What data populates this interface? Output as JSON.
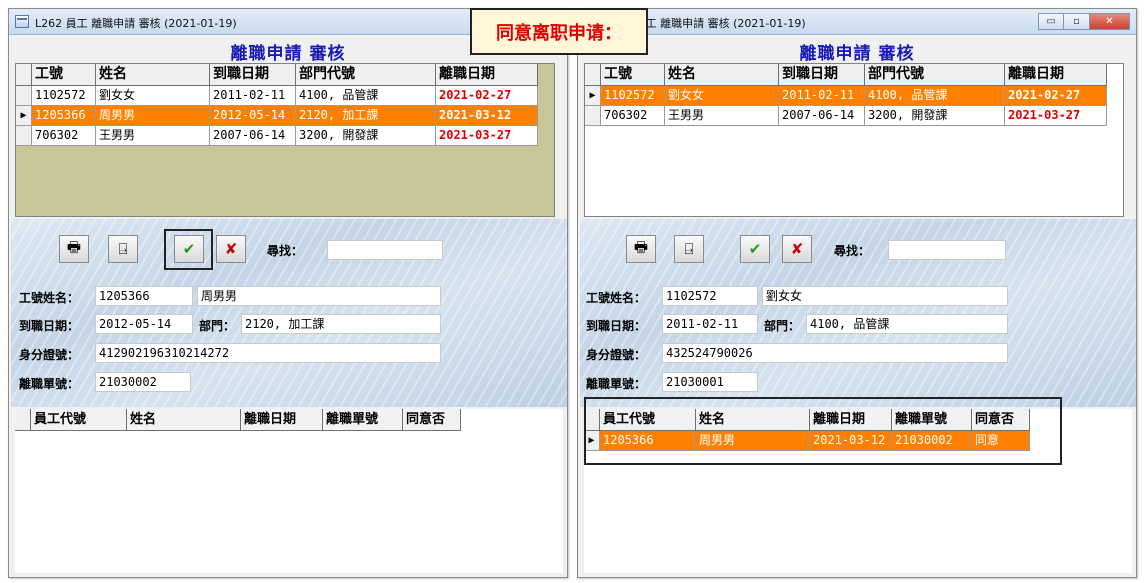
{
  "left": {
    "window_title": "L262 員工 離職申請 審核 (2021-01-19)",
    "form_title": "離職申請 審核",
    "grid_headers": [
      "工號",
      "姓名",
      "到職日期",
      "部門代號",
      "離職日期"
    ],
    "rows": [
      {
        "id": "1102572",
        "name": "劉女女",
        "join": "2011-02-11",
        "dept": "4100, 品管課",
        "leave": "2021-02-27",
        "selected": false
      },
      {
        "id": "1205366",
        "name": "周男男",
        "join": "2012-05-14",
        "dept": "2120, 加工課",
        "leave": "2021-03-12",
        "selected": true
      },
      {
        "id": "706302",
        "name": "王男男",
        "join": "2007-06-14",
        "dept": "3200, 開發課",
        "leave": "2021-03-27",
        "selected": false
      }
    ],
    "search_label": "尋找：",
    "search_value": "",
    "labels": {
      "emp": "工號姓名：",
      "join": "到職日期：",
      "dept": "部門：",
      "idno": "身分證號：",
      "form_no": "離職單號："
    },
    "detail": {
      "emp_id": "1205366",
      "emp_name": "周男男",
      "join_date": "2012-05-14",
      "dept": "2120, 加工課",
      "id_number": "412902196310214272",
      "form_no": "21030002"
    },
    "grid2_headers": [
      "員工代號",
      "姓名",
      "離職日期",
      "離職單號",
      "同意否"
    ],
    "grid2_rows": []
  },
  "right": {
    "window_title": "L262 員工 離職申請 審核 (2021-01-19)",
    "form_title": "離職申請 審核",
    "grid_headers": [
      "工號",
      "姓名",
      "到職日期",
      "部門代號",
      "離職日期"
    ],
    "rows": [
      {
        "id": "1102572",
        "name": "劉女女",
        "join": "2011-02-11",
        "dept": "4100, 品管課",
        "leave": "2021-02-27",
        "selected": true
      },
      {
        "id": "706302",
        "name": "王男男",
        "join": "2007-06-14",
        "dept": "3200, 開發課",
        "leave": "2021-03-27",
        "selected": false
      }
    ],
    "search_label": "尋找：",
    "search_value": "",
    "labels": {
      "emp": "工號姓名：",
      "join": "到職日期：",
      "dept": "部門：",
      "idno": "身分證號：",
      "form_no": "離職單號："
    },
    "detail": {
      "emp_id": "1102572",
      "emp_name": "劉女女",
      "join_date": "2011-02-11",
      "dept": "4100, 品管課",
      "id_number": "432524790026",
      "form_no": "21030001"
    },
    "grid2_headers": [
      "員工代號",
      "姓名",
      "離職日期",
      "離職單號",
      "同意否"
    ],
    "grid2_rows": [
      {
        "id": "1205366",
        "name": "周男男",
        "leave": "2021-03-12",
        "form_no": "21030002",
        "agree": "同意",
        "selected": true
      }
    ]
  },
  "window_buttons": {
    "min": "▭",
    "max": "▫",
    "close": "✕"
  },
  "toolbar_icons": [
    "print-icon",
    "exit-icon",
    "confirm-icon",
    "reject-icon"
  ],
  "toolbar_glyphs": {
    "print": "🖶",
    "exit": "⍈",
    "confirm": "✔",
    "reject": "✘"
  },
  "row_indicator": "▶",
  "callout": "同意离职申请：",
  "colors": {
    "selected_row": "#ff7f00",
    "leave_date": "#e00000",
    "form_title": "#1a1ab8",
    "callout_text": "#e00000"
  }
}
